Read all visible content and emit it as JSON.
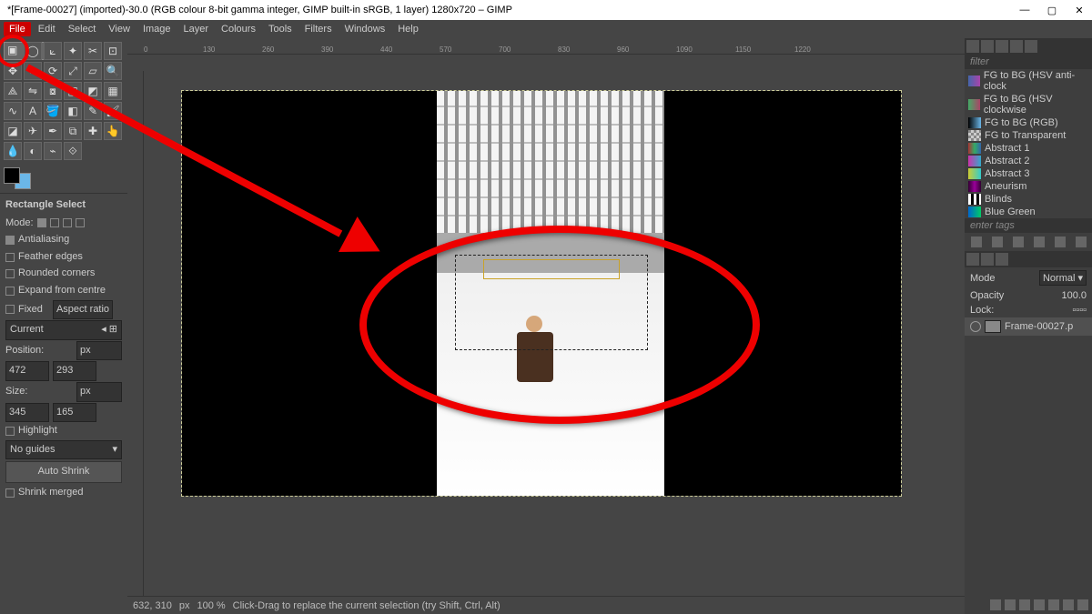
{
  "window": {
    "title": "*[Frame-00027] (imported)-30.0 (RGB colour 8-bit gamma integer, GIMP built-in sRGB, 1 layer) 1280x720 – GIMP",
    "controls": {
      "min": "—",
      "max": "▢",
      "close": "✕"
    }
  },
  "menu": [
    "File",
    "Edit",
    "Select",
    "View",
    "Image",
    "Layer",
    "Colours",
    "Tools",
    "Filters",
    "Windows",
    "Help"
  ],
  "tool_options": {
    "title": "Rectangle Select",
    "mode_label": "Mode:",
    "antialiasing": "Antialiasing",
    "feather": "Feather edges",
    "rounded": "Rounded corners",
    "expand": "Expand from centre",
    "fixed": "Fixed",
    "fixed_kind": "Aspect ratio",
    "current": "Current",
    "pos_label": "Position:",
    "pos_unit": "px",
    "pos_x": "472",
    "pos_y": "293",
    "size_label": "Size:",
    "size_unit": "px",
    "size_w": "345",
    "size_h": "165",
    "highlight": "Highlight",
    "guides": "No guides",
    "autoshrink": "Auto Shrink",
    "shrinkmerged": "Shrink merged"
  },
  "status": {
    "coords": "632, 310",
    "unit": "px",
    "zoom": "100 %",
    "help": "Click-Drag to replace the current selection (try Shift, Ctrl, Alt)"
  },
  "ruler_ticks": [
    "0",
    "130",
    "260",
    "390",
    "440",
    "570",
    "700",
    "830",
    "960",
    "1090",
    "1150",
    "1220"
  ],
  "right_panel": {
    "filter_label": "filter",
    "gradients": [
      {
        "name": "FG to BG (HSV anti-clock",
        "sw": "linear-gradient(90deg,#46a,#a4a)"
      },
      {
        "name": "FG to BG (HSV clockwise",
        "sw": "linear-gradient(90deg,#4a6,#a46)"
      },
      {
        "name": "FG to BG (RGB)",
        "sw": "linear-gradient(90deg,#000,#6bb7e8)"
      },
      {
        "name": "FG to Transparent",
        "sw": "repeating-conic-gradient(#888 0 25%,#ccc 0 50%) 0/6px 6px"
      },
      {
        "name": "Abstract 1",
        "sw": "linear-gradient(90deg,#a33,#3a6,#36a)"
      },
      {
        "name": "Abstract 2",
        "sw": "linear-gradient(90deg,#c3a,#3ac)"
      },
      {
        "name": "Abstract 3",
        "sw": "linear-gradient(90deg,#cc3,#3cc)"
      },
      {
        "name": "Aneurism",
        "sw": "linear-gradient(90deg,#303,#909,#303)"
      },
      {
        "name": "Blinds",
        "sw": "repeating-linear-gradient(90deg,#fff 0 3px,#000 3px 6px)"
      },
      {
        "name": "Blue Green",
        "sw": "linear-gradient(90deg,#06c,#0c6)"
      }
    ],
    "tags": "enter tags",
    "mode_label": "Mode",
    "mode_value": "Normal",
    "opacity_label": "Opacity",
    "opacity_value": "100.0",
    "lock_label": "Lock:",
    "layer_name": "Frame-00027.p"
  }
}
